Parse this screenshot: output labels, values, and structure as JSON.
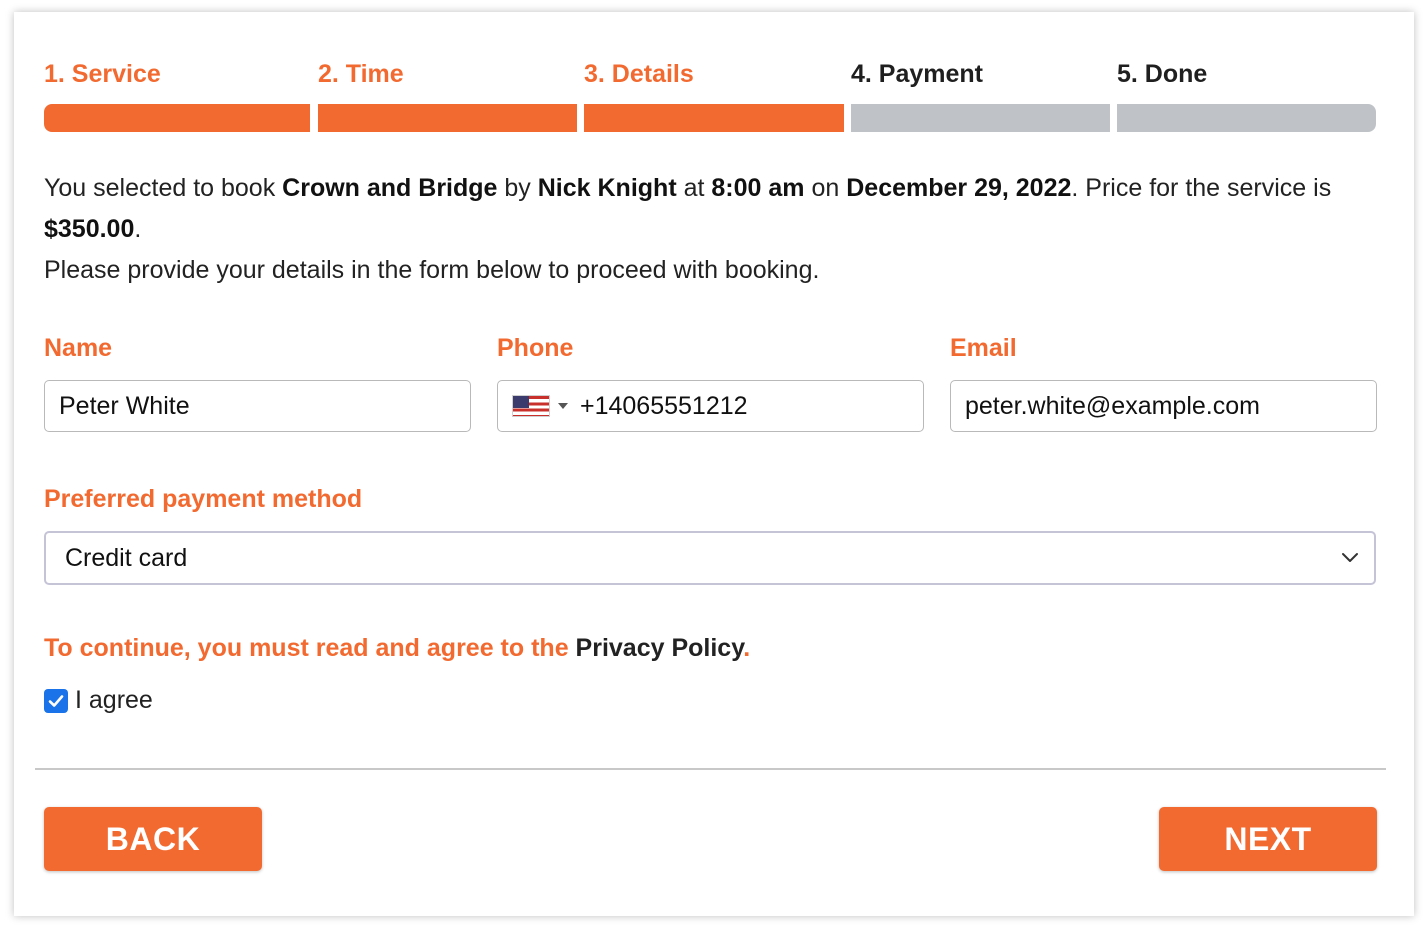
{
  "colors": {
    "accent": "#F26A30",
    "inactive_step": "#BFC3C7",
    "checkbox": "#1a73e8"
  },
  "steps": [
    {
      "label": "1. Service",
      "state": "done"
    },
    {
      "label": "2. Time",
      "state": "done"
    },
    {
      "label": "3. Details",
      "state": "done"
    },
    {
      "label": "4. Payment",
      "state": "todo"
    },
    {
      "label": "5. Done",
      "state": "todo"
    }
  ],
  "intro": {
    "t1": "You selected to book ",
    "service": "Crown and Bridge",
    "t2": " by ",
    "staff": "Nick Knight",
    "t3": " at ",
    "time": "8:00 am",
    "t4": " on ",
    "date": "December 29, 2022",
    "t5": ". Price for the service is ",
    "price": "$350.00",
    "t6": ".",
    "line2": "Please provide your details in the form below to proceed with booking."
  },
  "form": {
    "name_label": "Name",
    "name_value": "Peter White",
    "phone_label": "Phone",
    "phone_flag_icon": "us-flag-icon",
    "phone_value": "+14065551212",
    "email_label": "Email",
    "email_value": "peter.white@example.com",
    "payment_label": "Preferred payment method",
    "payment_value": "Credit card",
    "policy_text": "To continue, you must read and agree to the ",
    "policy_link": "Privacy Policy",
    "policy_end": ".",
    "agree_label": "I agree",
    "agree_checked": true
  },
  "buttons": {
    "back": "BACK",
    "next": "NEXT"
  }
}
